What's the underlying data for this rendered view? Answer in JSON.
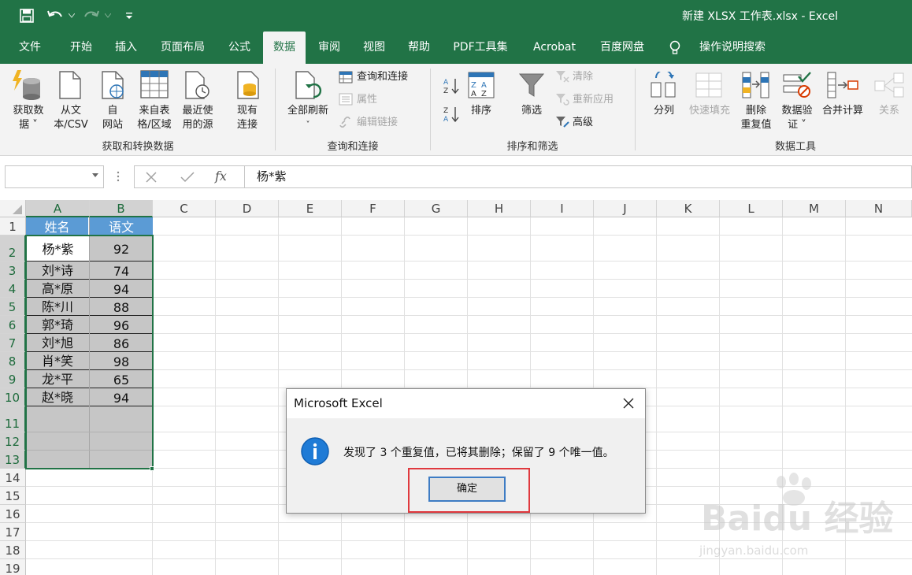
{
  "window": {
    "title": "新建 XLSX 工作表.xlsx  -  Excel"
  },
  "tabs": [
    {
      "label": "文件",
      "active": false
    },
    {
      "label": "开始",
      "active": false
    },
    {
      "label": "插入",
      "active": false
    },
    {
      "label": "页面布局",
      "active": false
    },
    {
      "label": "公式",
      "active": false
    },
    {
      "label": "数据",
      "active": true
    },
    {
      "label": "审阅",
      "active": false
    },
    {
      "label": "视图",
      "active": false
    },
    {
      "label": "帮助",
      "active": false
    },
    {
      "label": "PDF工具集",
      "active": false
    },
    {
      "label": "Acrobat",
      "active": false
    },
    {
      "label": "百度网盘",
      "active": false
    }
  ],
  "tell_me": "操作说明搜索",
  "ribbon": {
    "get_data": {
      "line1": "获取数",
      "line2": "据 ˅"
    },
    "from_text": {
      "line1": "从文",
      "line2": "本/CSV"
    },
    "from_web": {
      "line1": "自",
      "line2": "网站"
    },
    "from_table": {
      "line1": "来自表",
      "line2": "格/区域"
    },
    "recent_sources": {
      "line1": "最近使",
      "line2": "用的源"
    },
    "existing_conn": {
      "line1": "现有",
      "line2": "连接"
    },
    "group1": "获取和转换数据",
    "refresh_all": {
      "line1": "全部刷新",
      "line2": "˅"
    },
    "queries_connections": "查询和连接",
    "properties": "属性",
    "edit_links": "编辑链接",
    "group2": "查询和连接",
    "sort": "排序",
    "filter": "筛选",
    "clear": "清除",
    "reapply": "重新应用",
    "advanced": "高级",
    "group3": "排序和筛选",
    "text_to_columns": "分列",
    "flash_fill": "快速填充",
    "remove_dup": {
      "line1": "删除",
      "line2": "重复值"
    },
    "data_validation": {
      "line1": "数据验",
      "line2": "证 ˅"
    },
    "consolidate": "合并计算",
    "relationships": "关系",
    "group4": "数据工具"
  },
  "formula_bar": {
    "name_box": "",
    "formula": "杨*紫"
  },
  "sheet": {
    "columns": [
      "A",
      "B",
      "C",
      "D",
      "E",
      "F",
      "G",
      "H",
      "I",
      "J",
      "K",
      "L",
      "M",
      "N"
    ],
    "rows": [
      "1",
      "2",
      "3",
      "4",
      "5",
      "6",
      "7",
      "8",
      "9",
      "10",
      "11",
      "12",
      "13",
      "14",
      "15",
      "16",
      "17",
      "18",
      "19"
    ],
    "header": {
      "a": "姓名",
      "b": "语文"
    },
    "data": [
      {
        "name": "杨*紫",
        "score": "92"
      },
      {
        "name": "刘*诗",
        "score": "74"
      },
      {
        "name": "高*原",
        "score": "94"
      },
      {
        "name": "陈*川",
        "score": "88"
      },
      {
        "name": "郭*琦",
        "score": "96"
      },
      {
        "name": "刘*旭",
        "score": "86"
      },
      {
        "name": "肖*笑",
        "score": "98"
      },
      {
        "name": "龙*平",
        "score": "65"
      },
      {
        "name": "赵*晓",
        "score": "94"
      }
    ]
  },
  "dialog": {
    "title": "Microsoft Excel",
    "message": "发现了 3 个重复值，已将其删除；保留了 9 个唯一值。",
    "ok": "确定"
  },
  "watermark": {
    "brand": "Baidu 经验",
    "url": "jingyan.baidu.com"
  },
  "colors": {
    "excel_green": "#217346",
    "header_fill": "#5b9bd5",
    "selection_fill": "#c6c6c6",
    "highlight_red": "#e0393e"
  }
}
